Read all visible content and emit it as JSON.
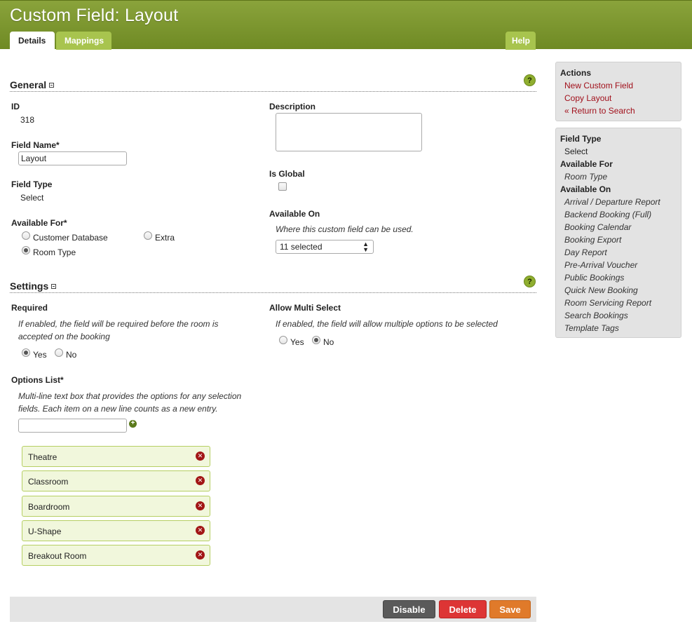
{
  "header": {
    "title": "Custom Field: Layout",
    "tabs": [
      "Details",
      "Mappings"
    ],
    "help": "Help"
  },
  "general": {
    "title": "General",
    "id_label": "ID",
    "id_value": "318",
    "field_name_label": "Field Name*",
    "field_name_value": "Layout",
    "field_type_label": "Field Type",
    "field_type_value": "Select",
    "available_for_label": "Available For*",
    "available_for_options": [
      "Customer Database",
      "Extra",
      "Room Type"
    ],
    "available_for_selected": "Room Type",
    "description_label": "Description",
    "is_global_label": "Is Global",
    "available_on_label": "Available On",
    "available_on_hint": "Where this custom field can be used.",
    "available_on_value": "11 selected"
  },
  "settings": {
    "title": "Settings",
    "required_label": "Required",
    "required_hint": "If enabled, the field will be required before the room is accepted on the booking",
    "required_yes": "Yes",
    "required_no": "No",
    "required_selected": "Yes",
    "multi_label": "Allow Multi Select",
    "multi_hint": "If enabled, the field will allow multiple options to be selected",
    "multi_yes": "Yes",
    "multi_no": "No",
    "multi_selected": "No",
    "options_label": "Options List*",
    "options_hint": "Multi-line text box that provides the options for any selection fields. Each item on a new line counts as a new entry.",
    "options": [
      "Theatre",
      "Classroom",
      "Boardroom",
      "U-Shape",
      "Breakout Room"
    ]
  },
  "footer": {
    "disable": "Disable",
    "delete": "Delete",
    "save": "Save"
  },
  "sidebar": {
    "actions_title": "Actions",
    "actions": [
      "New Custom Field",
      "Copy Layout",
      "« Return to Search"
    ],
    "field_type_title": "Field Type",
    "field_type_value": "Select",
    "available_for_title": "Available For",
    "available_for_value": "Room Type",
    "available_on_title": "Available On",
    "available_on_values": [
      "Arrival / Departure Report",
      "Backend Booking (Full)",
      "Booking Calendar",
      "Booking Export",
      "Day Report",
      "Pre-Arrival Voucher",
      "Public Bookings",
      "Quick New Booking",
      "Room Servicing Report",
      "Search Bookings",
      "Template Tags"
    ]
  },
  "colors": {
    "header_green": "#7a9530",
    "tab_green": "#a8c44e",
    "link_red": "#a1101b",
    "delete_red": "#dd3535",
    "save_orange": "#e07a2a"
  }
}
